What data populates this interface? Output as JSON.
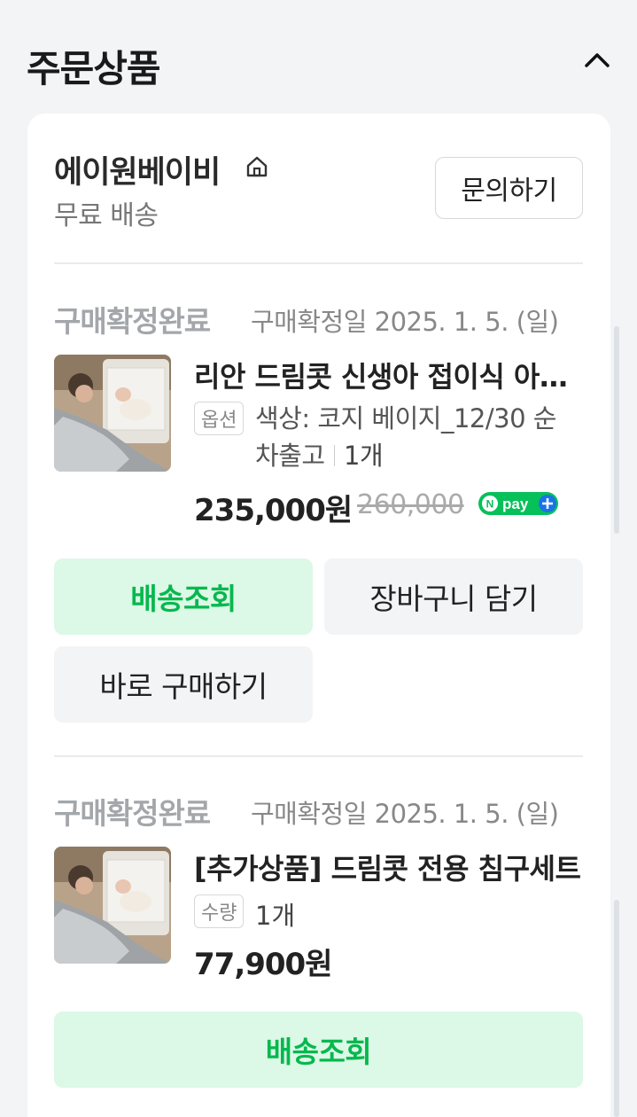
{
  "section": {
    "title": "주문상품",
    "collapse_icon": "chevron-up-icon"
  },
  "seller": {
    "name": "에이원베이비",
    "home_icon": "home-icon",
    "shipping": "무료 배송",
    "inquiry_label": "문의하기"
  },
  "orders": [
    {
      "status": "구매확정완료",
      "date": "구매확정일 2025. 1. 5. (일)",
      "name": "리안 드림콧 신생아 접이식 아기침대",
      "tag": "옵션",
      "option_line1": "색상: 코지 베이지_12/30 순",
      "option_line2": "차출고",
      "quantity": "1개",
      "price": "235,000원",
      "original_price": "260,000",
      "npay_label": "pay",
      "buttons": {
        "track": "배송조회",
        "cart": "장바구니 담기",
        "buy_now": "바로 구매하기"
      }
    },
    {
      "status": "구매확정완료",
      "date": "구매확정일 2025. 1. 5. (일)",
      "name": "[추가상품] 드림콧 전용 침구세트",
      "tag": "수량",
      "quantity": "1개",
      "price": "77,900원",
      "buttons": {
        "track": "배송조회"
      }
    }
  ],
  "colors": {
    "accent_green": "#06b84e",
    "green_bg": "#dcf8e6",
    "gray_bg": "#f2f4f6"
  }
}
